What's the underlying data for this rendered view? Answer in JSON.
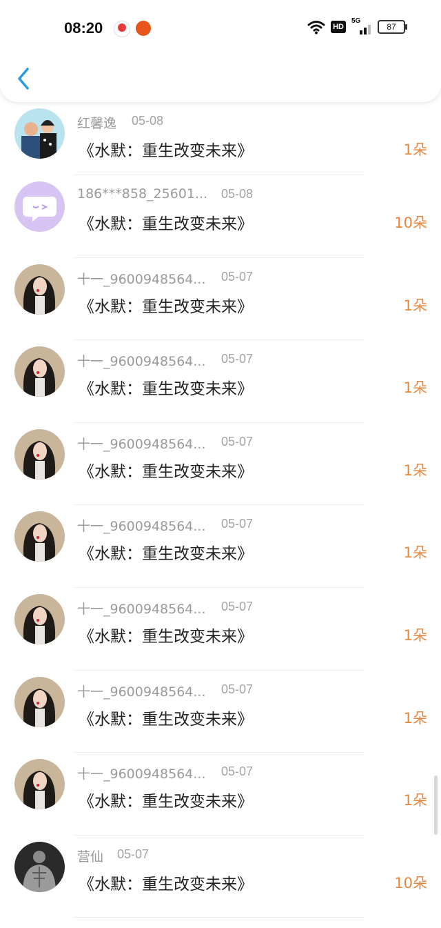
{
  "status_bar": {
    "time": "08:20",
    "hd": "HD",
    "network": "5G",
    "battery": "87"
  },
  "items": [
    {
      "name": "红馨逸",
      "date": "05-08",
      "book": "《水默：重生改变未来》",
      "count": "1朵",
      "avatar": "photo-couple"
    },
    {
      "name": "186***858_25601...",
      "date": "05-08",
      "book": "《水默：重生改变未来》",
      "count": "10朵",
      "avatar": "chat-bubble"
    },
    {
      "name": "十一_9600948564...",
      "date": "05-07",
      "book": "《水默：重生改变未来》",
      "count": "1朵",
      "avatar": "photo-girl"
    },
    {
      "name": "十一_9600948564...",
      "date": "05-07",
      "book": "《水默：重生改变未来》",
      "count": "1朵",
      "avatar": "photo-girl"
    },
    {
      "name": "十一_9600948564...",
      "date": "05-07",
      "book": "《水默：重生改变未来》",
      "count": "1朵",
      "avatar": "photo-girl"
    },
    {
      "name": "十一_9600948564...",
      "date": "05-07",
      "book": "《水默：重生改变未来》",
      "count": "1朵",
      "avatar": "photo-girl"
    },
    {
      "name": "十一_9600948564...",
      "date": "05-07",
      "book": "《水默：重生改变未来》",
      "count": "1朵",
      "avatar": "photo-girl"
    },
    {
      "name": "十一_9600948564...",
      "date": "05-07",
      "book": "《水默：重生改变未来》",
      "count": "1朵",
      "avatar": "photo-girl"
    },
    {
      "name": "十一_9600948564...",
      "date": "05-07",
      "book": "《水默：重生改变未来》",
      "count": "1朵",
      "avatar": "photo-girl"
    },
    {
      "name": "营仙",
      "date": "05-07",
      "book": "《水默：重生改变未来》",
      "count": "10朵",
      "avatar": "photo-man"
    }
  ],
  "colors": {
    "accent": "#e9853b",
    "back_icon": "#2a9be0",
    "muted_text": "#9a9a9a"
  }
}
